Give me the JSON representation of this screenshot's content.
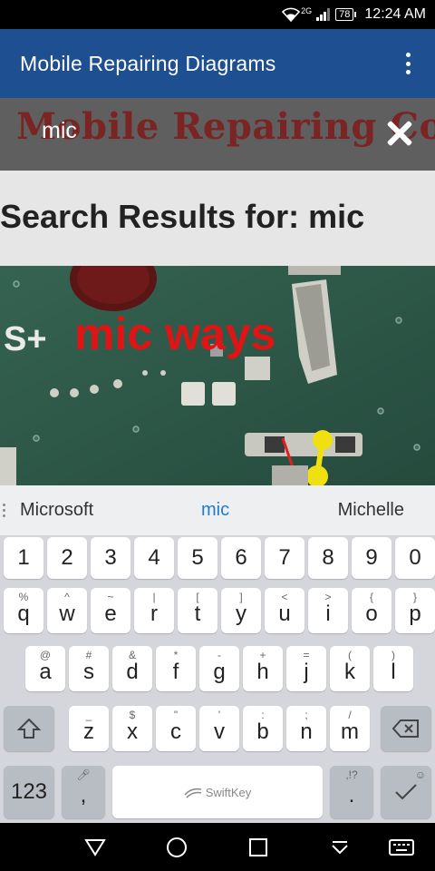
{
  "status": {
    "network_label": "2G",
    "battery": "78",
    "time": "12:24 AM"
  },
  "app": {
    "title": "Mobile Repairing Diagrams"
  },
  "search": {
    "banner_text": "Mobile Repairing Course",
    "query": "mic"
  },
  "results": {
    "heading_prefix": "Search Results for: ",
    "query": "mic"
  },
  "result_image": {
    "overlay_text": "mic ways",
    "left_label": "S+"
  },
  "keyboard": {
    "suggestions": [
      "Microsoft",
      "mic",
      "Michelle"
    ],
    "number_row": [
      "1",
      "2",
      "3",
      "4",
      "5",
      "6",
      "7",
      "8",
      "9",
      "0"
    ],
    "row1": [
      {
        "main": "q",
        "alt": "%"
      },
      {
        "main": "w",
        "alt": "^"
      },
      {
        "main": "e",
        "alt": "~"
      },
      {
        "main": "r",
        "alt": "|"
      },
      {
        "main": "t",
        "alt": "["
      },
      {
        "main": "y",
        "alt": "]"
      },
      {
        "main": "u",
        "alt": "<"
      },
      {
        "main": "i",
        "alt": ">"
      },
      {
        "main": "o",
        "alt": "{"
      },
      {
        "main": "p",
        "alt": "}"
      }
    ],
    "row2": [
      {
        "main": "a",
        "alt": "@"
      },
      {
        "main": "s",
        "alt": "#"
      },
      {
        "main": "d",
        "alt": "&"
      },
      {
        "main": "f",
        "alt": "*"
      },
      {
        "main": "g",
        "alt": "-"
      },
      {
        "main": "h",
        "alt": "+"
      },
      {
        "main": "j",
        "alt": "="
      },
      {
        "main": "k",
        "alt": "("
      },
      {
        "main": "l",
        "alt": ")"
      }
    ],
    "row3": [
      {
        "main": "z",
        "alt": "_"
      },
      {
        "main": "x",
        "alt": "$"
      },
      {
        "main": "c",
        "alt": "\""
      },
      {
        "main": "v",
        "alt": "'"
      },
      {
        "main": "b",
        "alt": ":"
      },
      {
        "main": "n",
        "alt": ";"
      },
      {
        "main": "m",
        "alt": "/"
      }
    ],
    "symbols_key": "123",
    "comma_key": ",",
    "period_key": ".",
    "period_alt": ",!?",
    "space_label": "SwiftKey"
  },
  "colors": {
    "app_bar": "#1e4f91",
    "suggestion_highlight": "#1e7bd0",
    "overlay_text": "#e01414"
  }
}
